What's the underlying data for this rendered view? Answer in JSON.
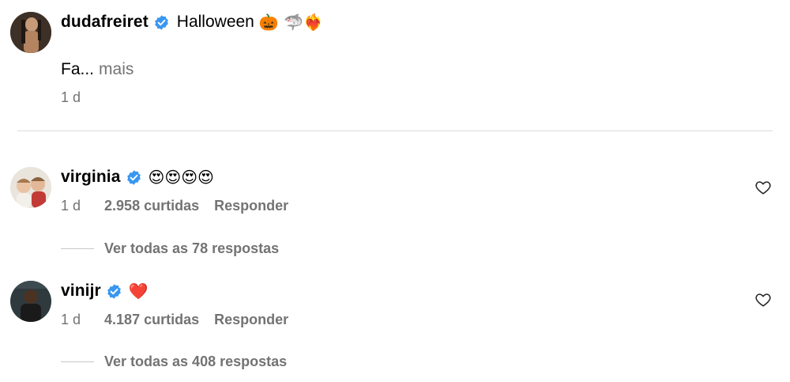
{
  "caption": {
    "username": "dudafreiret",
    "text": "Halloween",
    "emojis": "🎃 🦈❤️‍🔥",
    "body": "Fa...",
    "more": "mais",
    "time": "1 d"
  },
  "comments": [
    {
      "username": "virginia",
      "text": "😍😍😍😍",
      "time": "1 d",
      "likes": "2.958 curtidas",
      "reply": "Responder",
      "view_replies": "Ver todas as 78 respostas"
    },
    {
      "username": "vinijr",
      "text": "❤️",
      "time": "1 d",
      "likes": "4.187 curtidas",
      "reply": "Responder",
      "view_replies": "Ver todas as 408 respostas"
    }
  ],
  "colors": {
    "verified": "#3897f0",
    "secondary_text": "#737373",
    "divider": "#dbdbdb"
  }
}
